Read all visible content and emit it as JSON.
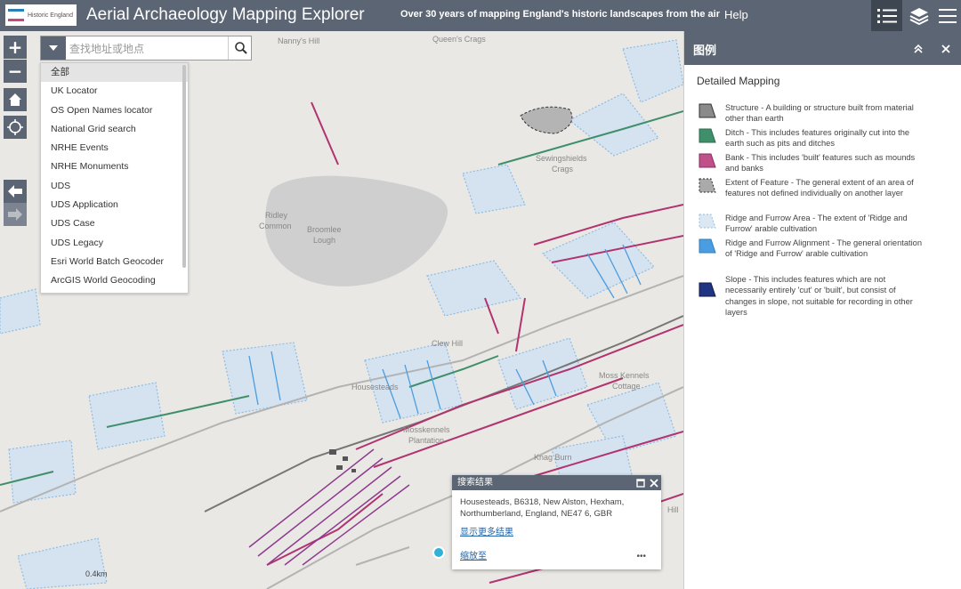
{
  "header": {
    "logo_text": "Historic England",
    "title": "Aerial Archaeology Mapping Explorer",
    "subtitle": "Over 30 years of mapping England's historic landscapes from the air",
    "help_label": "Help",
    "legend_icon": "list-icon",
    "layers_icon": "layers-icon",
    "menu_icon": "menu-icon"
  },
  "map_controls": {
    "zoom_in": "+",
    "zoom_out": "−",
    "home_icon": "home-icon",
    "locate_icon": "locate-icon",
    "back_icon": "arrow-left-icon",
    "forward_icon": "arrow-right-icon"
  },
  "search": {
    "placeholder": "查找地址或地点",
    "sources": [
      "全部",
      "UK Locator",
      "OS Open Names locator",
      "National Grid search",
      "NRHE Events",
      "NRHE Monuments",
      "UDS",
      "UDS Application",
      "UDS Case",
      "UDS Legacy",
      "Esri World Batch Geocoder",
      "ArcGIS World Geocoding"
    ],
    "selected_index": 0
  },
  "map_labels": {
    "nannys_hill": "Nanny's Hill",
    "queens_crags": "Queen's Crags",
    "sewingshields": "Sewingshields",
    "crags": "Crags",
    "ridley": "Ridley",
    "common": "Common",
    "broomlee": "Broomlee",
    "lough": "Lough",
    "clew_hill": "Clew Hill",
    "moss_kennels": "Moss Kennels",
    "cottage": "Cottage",
    "mosskennels": "Mosskennels",
    "plantation": "Plantation",
    "knag_burn": "Knag Burn",
    "housesteads": "Housesteads",
    "sheet_hill": "Hill",
    "scale": "0.4km"
  },
  "popup": {
    "title": "搜索结果",
    "address": "Housesteads, B6318, New Alston, Hexham, Northumberland, England, NE47 6, GBR",
    "more_results": "显示更多结果",
    "zoom_to": "缩放至",
    "more": "•••"
  },
  "legend": {
    "title": "图例",
    "layer": "Detailed Mapping",
    "items": [
      {
        "label": "Structure - A building or structure built from material other than earth",
        "color": "#8a8a8a"
      },
      {
        "label": "Ditch - This includes features originally cut into the earth such as pits and ditches",
        "color": "#3f8f6a"
      },
      {
        "label": "Bank - This includes 'built' features such as mounds and banks",
        "color": "#c0508a"
      },
      {
        "label": "Extent of Feature - The general extent of an area of features not defined individually on another layer",
        "color": "#aaaaaa"
      },
      {
        "label": "Ridge and Furrow Area - The extent of 'Ridge and Furrow' arable cultivation",
        "color": "#a8cbe8"
      },
      {
        "label": "Ridge and Furrow Alignment - The general orientation of 'Ridge and Furrow' arable cultivation",
        "color": "#4a9de0"
      },
      {
        "label": "Slope - This includes features which are not necessarily entirely 'cut' or 'built', but consist of changes in slope, not suitable for recording in other layers",
        "color": "#1f3584"
      }
    ]
  }
}
